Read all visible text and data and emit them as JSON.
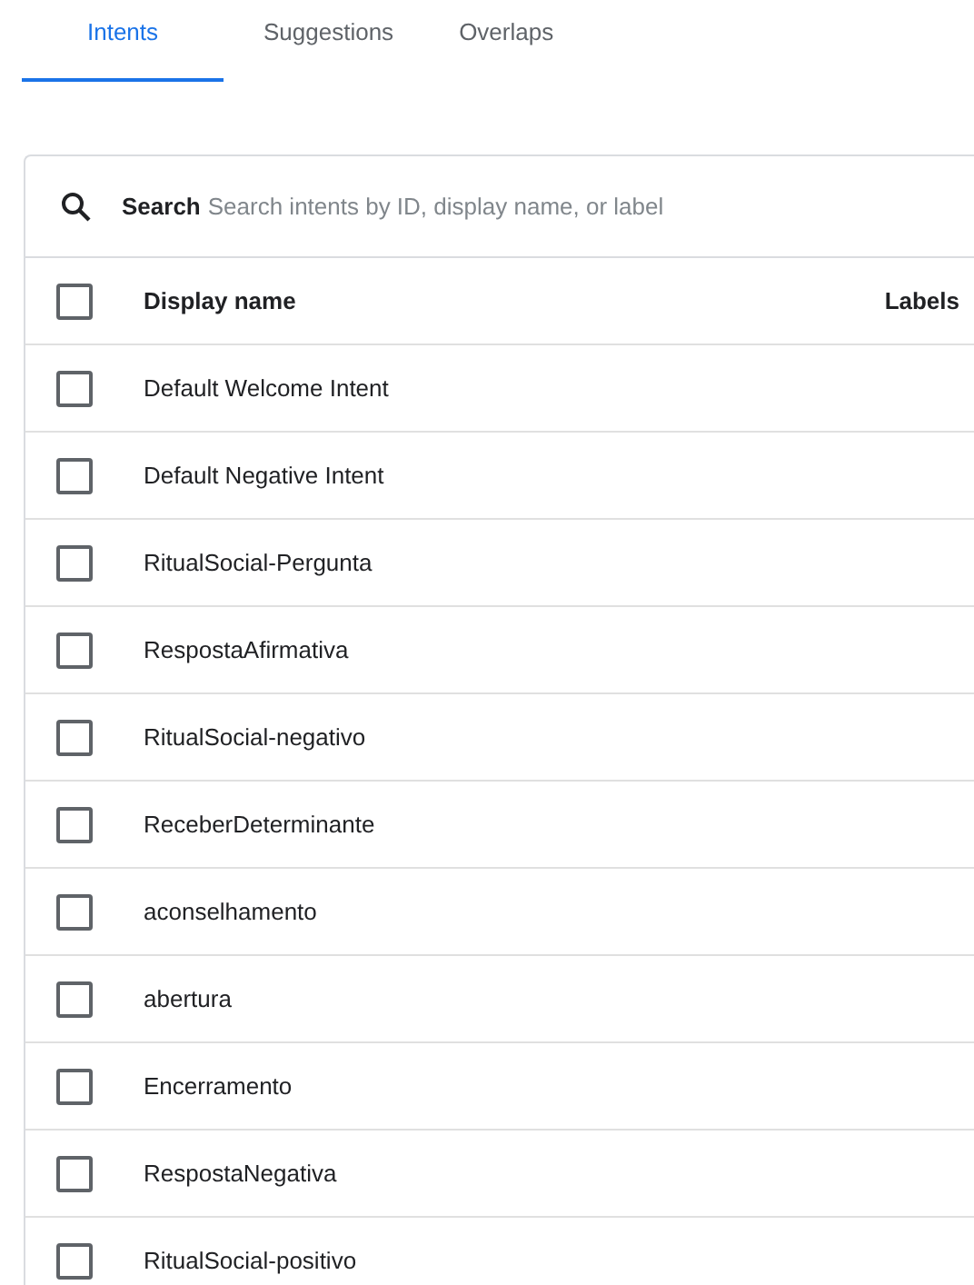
{
  "tabs": [
    {
      "label": "Intents",
      "selected": true
    },
    {
      "label": "Suggestions",
      "selected": false
    },
    {
      "label": "Overlaps",
      "selected": false
    }
  ],
  "search": {
    "label": "Search",
    "placeholder": "Search intents by ID, display name, or label"
  },
  "table": {
    "columns": [
      "Display name",
      "Labels"
    ],
    "header_checked": false,
    "rows": [
      {
        "name": "Default Welcome Intent",
        "checked": false
      },
      {
        "name": "Default Negative Intent",
        "checked": false
      },
      {
        "name": "RitualSocial-Pergunta",
        "checked": false
      },
      {
        "name": "RespostaAfirmativa",
        "checked": false
      },
      {
        "name": "RitualSocial-negativo",
        "checked": false
      },
      {
        "name": "ReceberDeterminante",
        "checked": false
      },
      {
        "name": "aconselhamento",
        "checked": false
      },
      {
        "name": "abertura",
        "checked": false
      },
      {
        "name": "Encerramento",
        "checked": false
      },
      {
        "name": "RespostaNegativa",
        "checked": false
      },
      {
        "name": "RitualSocial-positivo",
        "checked": false
      }
    ]
  }
}
